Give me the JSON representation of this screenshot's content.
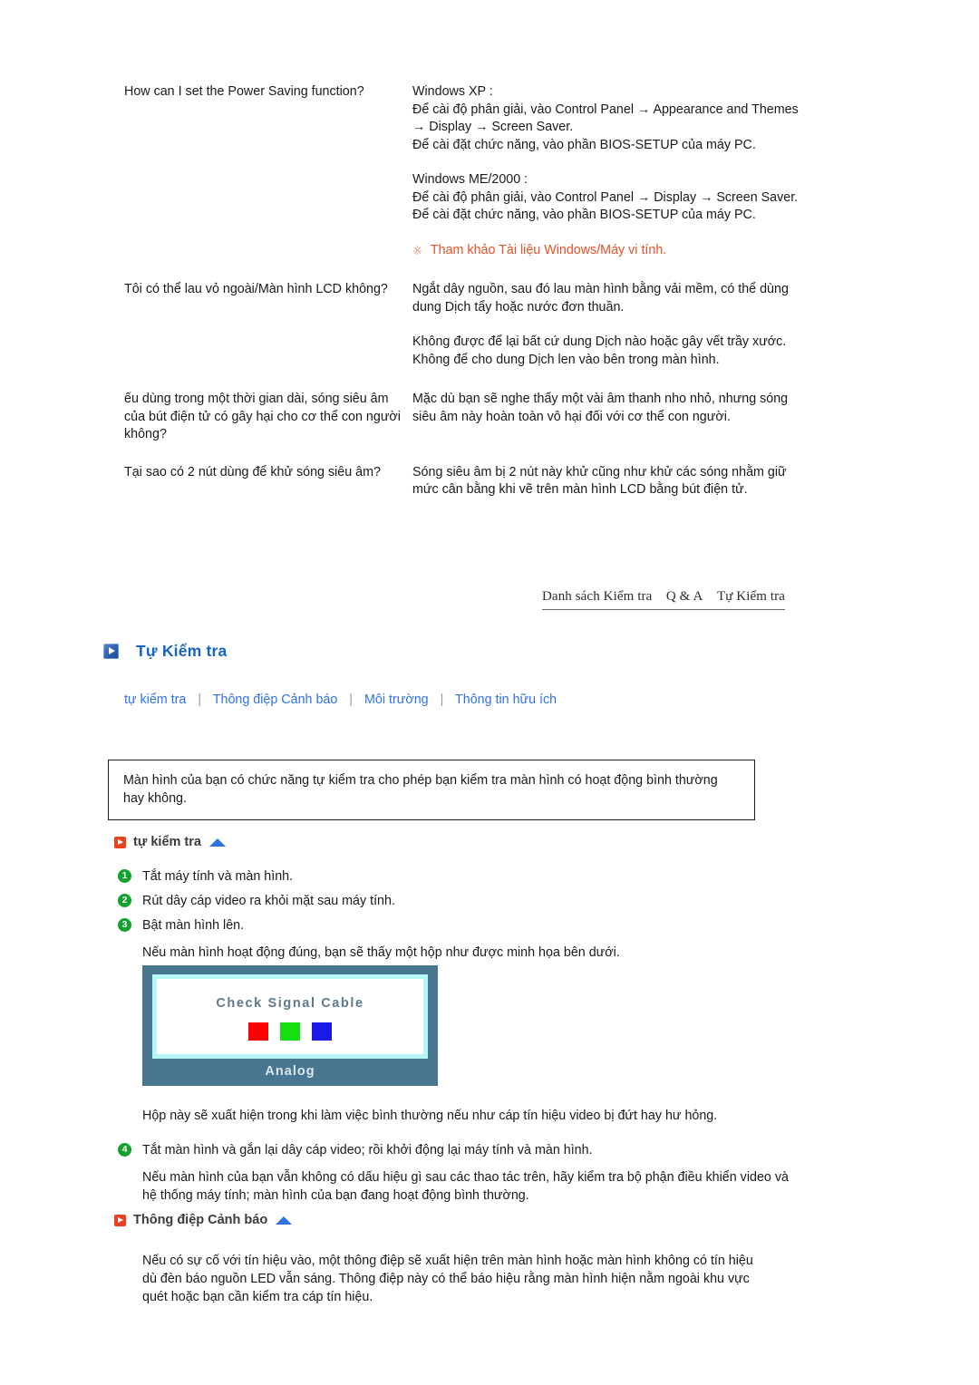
{
  "faq": {
    "rows": [
      {
        "question": "How can I set the Power Saving function?",
        "answer_parts": [
          "Windows XP :\nĐể cài độ phân giải, vào Control Panel → Appearance and Themes → Display → Screen Saver.\nĐể cài đặt chức năng, vào phần BIOS-SETUP của máy PC.",
          "Windows ME/2000 :\nĐể cài độ phân giải, vào Control Panel → Display → Screen Saver.\nĐể cài đặt chức năng, vào phần BIOS-SETUP của máy PC."
        ],
        "note_mark": "※",
        "note": "Tham khảo Tài liệu Windows/Máy vi tính."
      },
      {
        "question": "Tôi có thể lau vỏ ngoài/Màn hình LCD không?",
        "answer_parts": [
          "Ngắt dây nguồn, sau đó lau màn hình bằng vải mềm, có thể dùng dung Dịch tẩy hoặc nước đơn thuần.",
          "Không được để lại bất cứ dung Dịch nào hoặc gây vết trầy xước. Không để cho dung Dịch len vào bên trong màn hình."
        ],
        "note_mark": "",
        "note": ""
      },
      {
        "question": "ếu dùng trong một thời gian dài, sóng siêu âm của bút điện tử có gây hại cho cơ thể con người không?",
        "answer_parts": [
          "Mặc dù bạn sẽ nghe thấy một vài âm thanh nho nhỏ, nhưng sóng siêu âm này hoàn toàn vô hại đối với cơ thể con người."
        ],
        "note_mark": "",
        "note": ""
      },
      {
        "question": "Tại sao có 2 nút dùng để khử sóng siêu âm?",
        "answer_parts": [
          "Sóng siêu âm bị 2 nút này khử cũng như khử các sóng nhằm giữ mức cân bằng khi vẽ trên màn hình LCD bằng bút điện tử."
        ],
        "note_mark": "",
        "note": ""
      }
    ]
  },
  "navbar": {
    "items": [
      "Danh sách Kiểm tra",
      "Q & A",
      "Tự Kiểm tra"
    ]
  },
  "section": {
    "title": "Tự Kiểm tra"
  },
  "links": {
    "items": [
      "tự kiểm tra",
      "Thông điệp Cảnh báo",
      "Môi trường",
      "Thông tin hữu ích"
    ],
    "separator": "|"
  },
  "intro": {
    "text": "Màn hình của bạn có chức năng tự kiểm tra cho phép bạn kiểm tra màn hình có hoạt động bình thường hay không."
  },
  "self_test": {
    "heading": "tự kiểm tra",
    "steps": [
      {
        "num": "1",
        "text": "Tắt máy tính và màn hình."
      },
      {
        "num": "2",
        "text": "Rút dây cáp video ra khỏi mặt sau máy tính."
      },
      {
        "num": "3",
        "text": "Bật màn hình lên."
      }
    ],
    "after_step3": "Nếu màn hình hoạt động đúng, bạn sẽ thấy một hộp như được minh họa bên dưới.",
    "box_note": "Hộp này sẽ xuất hiện trong khi làm việc bình thường nếu như cáp tín hiệu video bị đứt hay hư hỏng.",
    "step4": {
      "num": "4",
      "text": "Tắt màn hình và gắn lại dây cáp video; rồi khởi động lại máy tính và màn hình."
    },
    "after_step4": "Nếu màn hình của bạn vẫn không có dấu hiệu gì sau các thao tác trên, hãy kiểm tra bộ phận điều khiển video và hệ thống máy tính; màn hình của bạn đang hoạt động bình thường."
  },
  "monitor_message": {
    "title": "Check Signal Cable",
    "label": "Analog",
    "swatch_colors": [
      "#fc0000",
      "#14e014",
      "#1a1ae6"
    ],
    "frame_color": "#48758f",
    "inner_border_color": "#b5f6f6"
  },
  "warning_section": {
    "heading": "Thông điệp Cảnh báo",
    "text": "Nếu có sự cố với tín hiệu vào, một thông điệp sẽ xuất hiện trên màn hình hoặc màn hình không có tín hiệu dù đèn báo nguồn LED vẫn sáng. Thông điệp này có thể báo hiệu rằng màn hình hiện nằm ngoài khu vực quét hoặc bạn cần kiểm tra cáp tín hiệu."
  },
  "colors": {
    "accent_blue": "#1565c0",
    "link_blue": "#3072e3",
    "note_orange": "#e3522b",
    "step_green": "#12a22d",
    "badge_red": "#e8431f"
  }
}
